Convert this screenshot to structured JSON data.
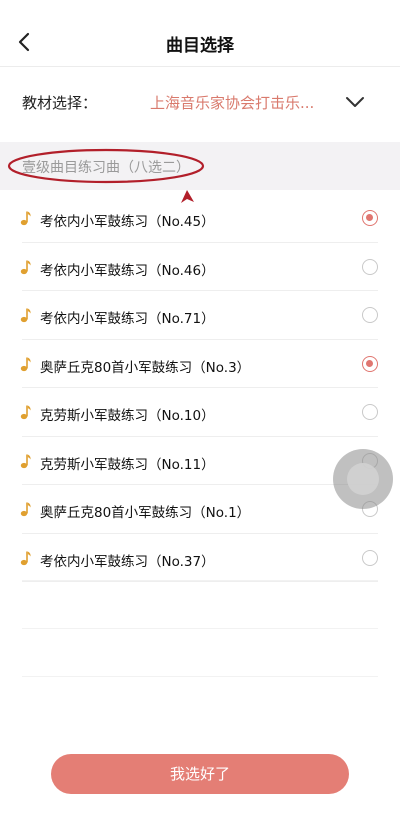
{
  "header": {
    "title": "曲目选择",
    "back_icon": "chevron-left-icon"
  },
  "textbook": {
    "label": "教材选择：",
    "value": "上海音乐家协会打击乐...",
    "value_color": "#d97a6d",
    "dropdown_icon": "chevron-down-icon"
  },
  "section": {
    "title": "壹级曲目练习曲（八选二）",
    "annotation_color": "#b21f2a"
  },
  "items": [
    {
      "label": "考依内小军鼓练习（No.45）",
      "selected": true
    },
    {
      "label": "考依内小军鼓练习（No.46）",
      "selected": false
    },
    {
      "label": "考依内小军鼓练习（No.71）",
      "selected": false
    },
    {
      "label": "奥萨丘克80首小军鼓练习（No.3）",
      "selected": true
    },
    {
      "label": "克劳斯小军鼓练习（No.10）",
      "selected": false
    },
    {
      "label": "克劳斯小军鼓练习（No.11）",
      "selected": false
    },
    {
      "label": "奥萨丘克80首小军鼓练习（No.1）",
      "selected": false
    },
    {
      "label": "考依内小军鼓练习（No.37）",
      "selected": false
    }
  ],
  "confirm_button": {
    "label": "我选好了",
    "color": "#e47e75"
  },
  "accent_color": "#e07670",
  "note_icon_color": "#e0a030"
}
